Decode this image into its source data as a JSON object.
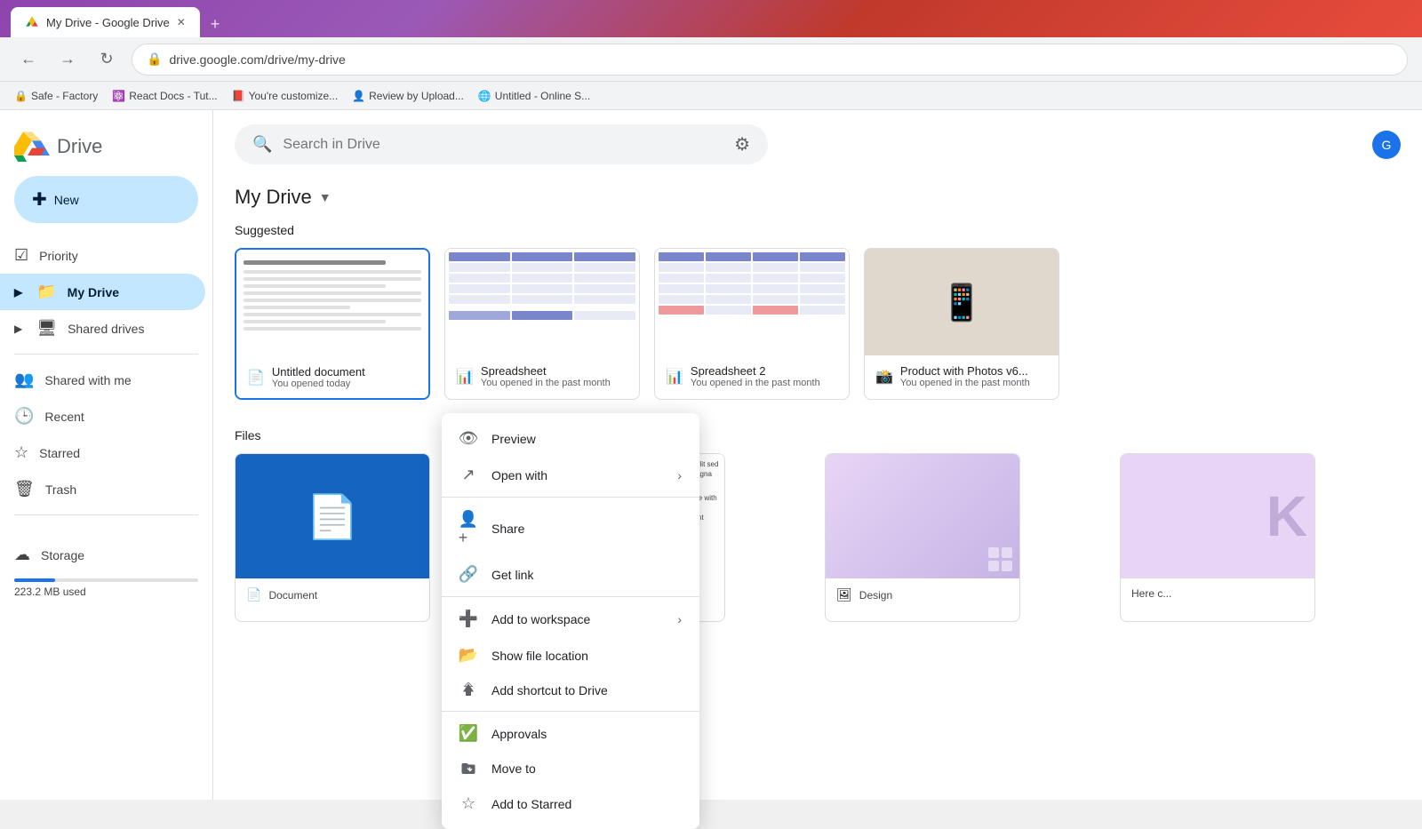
{
  "browser": {
    "tab_title": "My Drive - Google Drive",
    "url": "drive.google.com/drive/my-drive",
    "bookmarks": [
      {
        "label": "Safe - Factory",
        "icon": "🔒"
      },
      {
        "label": "React Docs - Tut...",
        "icon": "⚛️"
      },
      {
        "label": "You're customize...",
        "icon": "📕"
      },
      {
        "label": "Review by Upload...",
        "icon": "👤"
      },
      {
        "label": "Untitled - Online S...",
        "icon": "🌐"
      }
    ]
  },
  "app": {
    "logo_text": "Drive",
    "search_placeholder": "Search in Drive"
  },
  "sidebar": {
    "new_button": "New",
    "items": [
      {
        "label": "Priority",
        "icon": "check_circle",
        "active": false
      },
      {
        "label": "My Drive",
        "icon": "folder",
        "active": true,
        "has_chevron": true
      },
      {
        "label": "Shared drives",
        "icon": "people",
        "active": false,
        "has_chevron": true
      },
      {
        "label": "Shared with me",
        "icon": "person_add",
        "active": false
      },
      {
        "label": "Recent",
        "icon": "history",
        "active": false
      },
      {
        "label": "Starred",
        "icon": "star",
        "active": false
      },
      {
        "label": "Trash",
        "icon": "delete",
        "active": false
      }
    ],
    "storage": {
      "label": "Storage",
      "used": "223.2 MB used"
    }
  },
  "main": {
    "drive_title": "My Drive",
    "suggested_label": "Suggested",
    "files_label": "Files",
    "suggested_files": [
      {
        "name": "Untitled document",
        "meta": "You opened today",
        "type": "doc",
        "icon_color": "#4285f4"
      },
      {
        "name": "Spreadsheet",
        "meta": "You opened in the past month",
        "type": "sheet",
        "icon_color": "#0f9d58"
      },
      {
        "name": "Spreadsheet 2",
        "meta": "You opened in the past month",
        "type": "sheet",
        "icon_color": "#0f9d58"
      },
      {
        "name": "Product with Photos v6...",
        "meta": "You opened in the past month",
        "type": "photo",
        "icon_color": "#ea4335"
      }
    ]
  },
  "context_menu": {
    "items": [
      {
        "label": "Preview",
        "icon": "visibility",
        "has_arrow": false
      },
      {
        "label": "Open with",
        "icon": "open_in_new",
        "has_arrow": true
      },
      {
        "label": "Share",
        "icon": "person_add",
        "has_arrow": false
      },
      {
        "label": "Get link",
        "icon": "link",
        "has_arrow": false
      },
      {
        "label": "Add to workspace",
        "icon": "add",
        "has_arrow": true
      },
      {
        "label": "Show file location",
        "icon": "folder_open",
        "has_arrow": false
      },
      {
        "label": "Add shortcut to Drive",
        "icon": "add_to_drive",
        "has_arrow": false
      },
      {
        "label": "Approvals",
        "icon": "approval",
        "has_arrow": false
      },
      {
        "label": "Move to",
        "icon": "drive_file_move",
        "has_arrow": false
      },
      {
        "label": "Add to Starred",
        "icon": "star_border",
        "has_arrow": false
      }
    ]
  }
}
